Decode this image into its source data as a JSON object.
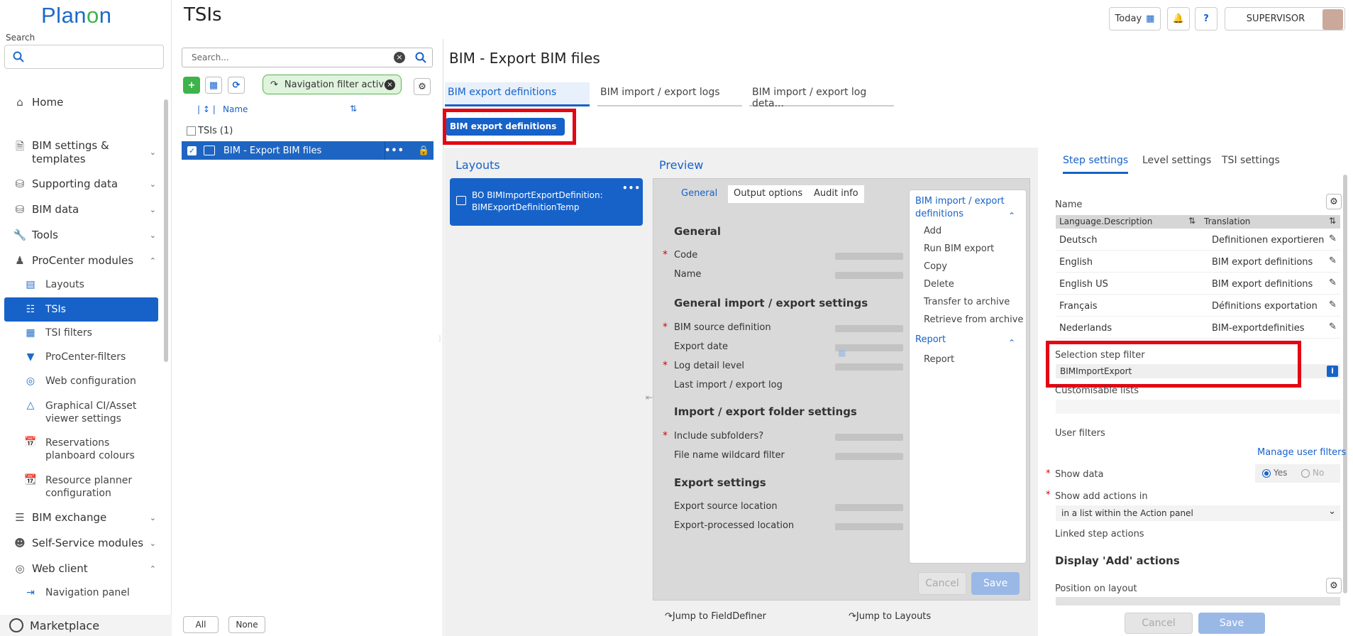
{
  "app": {
    "logo_text_1": "Plan",
    "logo_text_2": "o",
    "logo_text_3": "n",
    "page_title": "TSIs"
  },
  "sidebar": {
    "search_label": "Search",
    "items": [
      {
        "label": "Home",
        "icon": "home-icon"
      },
      {
        "label": "BIM settings &",
        "label2": "templates",
        "icon": "document-icon"
      },
      {
        "label": "Supporting data",
        "icon": "database-icon"
      },
      {
        "label": "BIM data",
        "icon": "database-icon"
      },
      {
        "label": "Tools",
        "icon": "wrench-icon"
      },
      {
        "label": "ProCenter modules",
        "icon": "user-settings-icon"
      }
    ],
    "sub_items": [
      {
        "label": "Layouts",
        "icon": "layout-icon"
      },
      {
        "label": "TSIs",
        "icon": "tsi-icon"
      },
      {
        "label": "TSI filters",
        "icon": "filter-icon"
      },
      {
        "label": "ProCenter-filters",
        "icon": "funnel-icon"
      },
      {
        "label": "Web configuration",
        "icon": "globe-icon"
      },
      {
        "label": "Graphical CI/Asset",
        "label2": "viewer settings",
        "icon": "triangle-icon"
      },
      {
        "label": "Reservations",
        "label2": "planboard colours",
        "icon": "calendar-icon"
      },
      {
        "label": "Resource planner",
        "label2": "configuration",
        "icon": "calendar-gear-icon"
      }
    ],
    "items_bottom": [
      {
        "label": "BIM exchange",
        "icon": "list-icon"
      },
      {
        "label": "Self-Service modules",
        "icon": "person-icon"
      },
      {
        "label": "Web client",
        "icon": "globe-icon"
      }
    ],
    "nav_panel": "Navigation panel",
    "marketplace": "Marketplace"
  },
  "header": {
    "today": "Today",
    "help": "?",
    "user": "SUPERVISOR"
  },
  "list_panel": {
    "search_placeholder": "Search...",
    "nav_filter": "Navigation filter active",
    "col_sort": "↕",
    "col_name": "Name",
    "group": "TSIs (1)",
    "row": "BIM - Export BIM files",
    "btn_all": "All",
    "btn_none": "None"
  },
  "main": {
    "title": "BIM - Export BIM files",
    "tabs": [
      "BIM export definitions",
      "BIM import / export logs",
      "BIM import / export log deta..."
    ],
    "subtab": "BIM export definitions",
    "layouts_title": "Layouts",
    "preview_title": "Preview",
    "layout_card_line1": "BO BIMImportExportDefinition:",
    "layout_card_line2": "BIMExportDefinitionTemp",
    "preview_tabs": [
      "General",
      "Output options",
      "Audit info"
    ],
    "sections": [
      {
        "title": "General"
      },
      {
        "title": "General import / export settings"
      },
      {
        "title": "Import / export folder settings"
      },
      {
        "title": "Export settings"
      }
    ],
    "fields": {
      "code": "Code",
      "name": "Name",
      "bim_source": "BIM source definition",
      "export_date": "Export date",
      "log_detail": "Log detail level",
      "last_log": "Last import / export log",
      "include_sub": "Include subfolders?",
      "wildcard": "File name wildcard filter",
      "export_source": "Export source location",
      "export_processed": "Export-processed location"
    },
    "actions": {
      "group1_line1": "BIM import / export",
      "group1_line2": "definitions",
      "items1": [
        "Add",
        "Run BIM export",
        "Copy",
        "Delete",
        "Transfer to archive",
        "Retrieve from archive"
      ],
      "group2": "Report",
      "items2": [
        "Report"
      ]
    },
    "cancel": "Cancel",
    "save": "Save",
    "jump_fielddefiner": "Jump to FieldDefiner",
    "jump_layouts": "Jump to Layouts"
  },
  "settings": {
    "tabs": [
      "Step settings",
      "Level settings",
      "TSI settings"
    ],
    "name_label": "Name",
    "col_lang": "Language.Description",
    "col_trans": "Translation",
    "translations": [
      {
        "lang": "Deutsch",
        "text": "Definitionen exportieren"
      },
      {
        "lang": "English",
        "text": "BIM export definitions"
      },
      {
        "lang": "English US",
        "text": "BIM export definitions"
      },
      {
        "lang": "Français",
        "text": "Définitions exportation"
      },
      {
        "lang": "Nederlands",
        "text": "BIM-exportdefinities"
      }
    ],
    "selection_filter_label": "Selection step filter",
    "selection_filter_value": "BIMImportExport",
    "customisable_lists": "Customisable lists",
    "user_filters": "User filters",
    "manage_user_filters": "Manage user filters",
    "show_data": "Show data",
    "yes": "Yes",
    "no": "No",
    "show_add_actions": "Show add actions in",
    "show_add_value": "in a list within the Action panel",
    "linked_step_actions": "Linked step actions",
    "display_add": "Display 'Add' actions",
    "position_on_layout": "Position on layout",
    "cancel": "Cancel",
    "save": "Save"
  },
  "colors": {
    "accent": "#1662c9",
    "highlight_red": "#e30613",
    "filter_green": "#58b44e"
  }
}
